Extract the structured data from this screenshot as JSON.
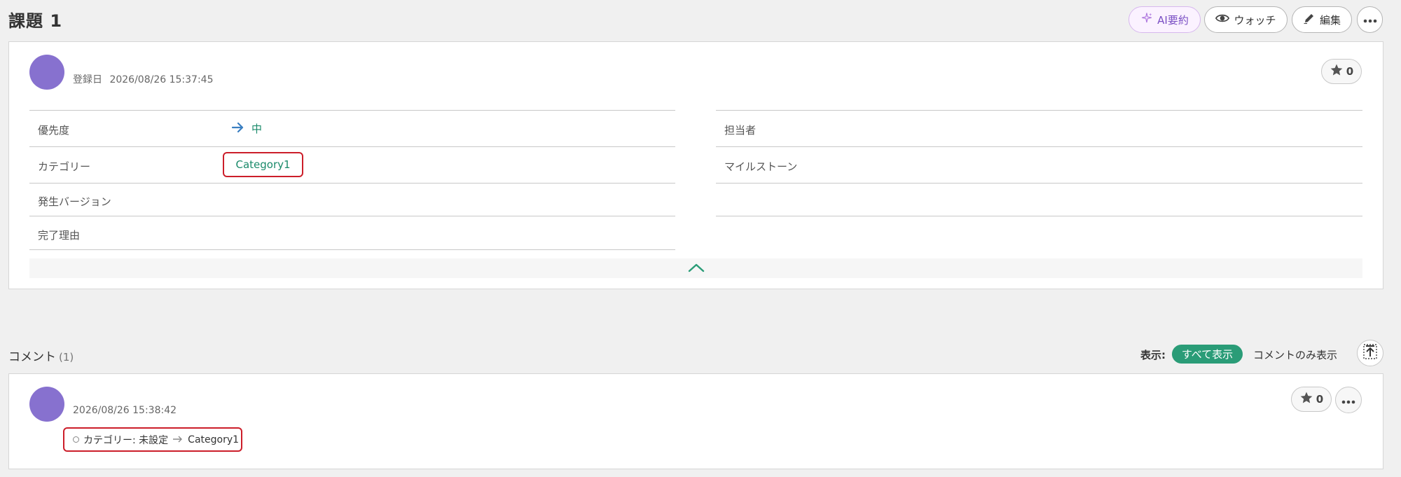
{
  "header": {
    "title": "課題 1",
    "ai_summary_label": "AI要約",
    "watch_label": "ウォッチ",
    "edit_label": "編集"
  },
  "issue": {
    "registered_label": "登録日",
    "registered_at": "2026/08/26 15:37:45",
    "star_count": "0",
    "fields_left": [
      {
        "label": "優先度",
        "value": "中"
      },
      {
        "label": "カテゴリー",
        "value": "Category1"
      },
      {
        "label": "発生バージョン",
        "value": ""
      },
      {
        "label": "完了理由",
        "value": ""
      }
    ],
    "fields_right": [
      {
        "label": "担当者",
        "value": ""
      },
      {
        "label": "マイルストーン",
        "value": ""
      }
    ]
  },
  "comments": {
    "title": "コメント",
    "count": "(1)",
    "display_label": "表示:",
    "filter_all": "すべて表示",
    "filter_comments_only": "コメントのみ表示",
    "items": [
      {
        "timestamp": "2026/08/26 15:38:42",
        "star_count": "0",
        "change_text": "カテゴリー: 未設定",
        "change_to": "Category1"
      }
    ]
  },
  "colors": {
    "accent_green": "#2a9c77",
    "avatar": "#8771cf",
    "highlight_red": "#cc1e2a",
    "priority_arrow": "#3a7fc1"
  },
  "icons": {
    "ai": "sparkle-icon",
    "watch": "eye-icon",
    "edit": "pencil-icon",
    "more": "more-horizontal-icon",
    "star": "star-icon",
    "priority": "arrow-right-icon",
    "collapse": "chevron-up-icon",
    "scroll_top": "scroll-to-top-icon"
  }
}
